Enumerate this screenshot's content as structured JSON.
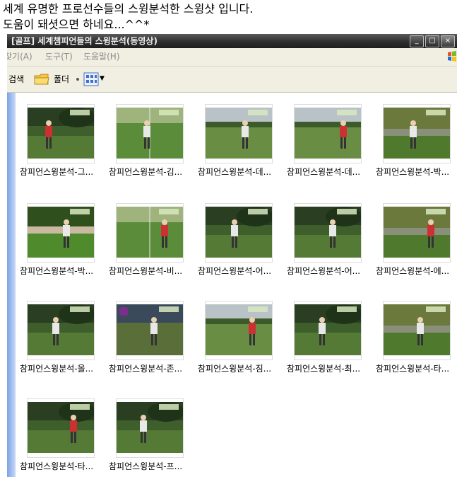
{
  "post": {
    "line1": "세계 유명한 프로선수들의 스윙분석한 스윙샷 입니다.",
    "line2": "도움이 돼셧으면 하네요...^^*"
  },
  "window": {
    "title": "[골프] 세계챔피언들의 스윙분석(동영상)",
    "controls": {
      "minimize": "_",
      "maximize": "□",
      "close": "×"
    }
  },
  "menu": [
    "찾기(A)",
    "도구(T)",
    "도움말(H)"
  ],
  "toolbar": {
    "search_label": "검색",
    "folders_label": "폴더"
  },
  "colors": {
    "titlebar": "#2e2e2e",
    "menubar": "#f1efe2",
    "left_pane": "#7ba2e7"
  },
  "files": [
    {
      "name": "참피언스윙분석-그...",
      "scene": "grass-dark"
    },
    {
      "name": "참피언스윙분석-김...",
      "scene": "split-grass"
    },
    {
      "name": "참피언스윙분석-데...",
      "scene": "fairway-sky"
    },
    {
      "name": "참피언스윙분석-데...",
      "scene": "fairway-sky"
    },
    {
      "name": "참피언스윙분석-박...",
      "scene": "crowd-trees"
    },
    {
      "name": "참피언스윙분석-박...",
      "scene": "crowd-green"
    },
    {
      "name": "참피언스윙분석-비...",
      "scene": "split-grass"
    },
    {
      "name": "참피언스윙분석-어...",
      "scene": "grass-dark"
    },
    {
      "name": "참피언스윙분석-어...",
      "scene": "grass-dark"
    },
    {
      "name": "참피언스윙분석-에...",
      "scene": "crowd-trees"
    },
    {
      "name": "참피언스윙분석-올...",
      "scene": "grass-dark"
    },
    {
      "name": "참피언스윙분석-존...",
      "scene": "crowd-purple"
    },
    {
      "name": "참피언스윙분석-짐...",
      "scene": "fairway-sky"
    },
    {
      "name": "참피언스윙분석-최...",
      "scene": "grass-dark"
    },
    {
      "name": "참피언스윙분석-타...",
      "scene": "crowd-trees"
    },
    {
      "name": "참피언스윙분석-타...",
      "scene": "grass-dark"
    },
    {
      "name": "참피언스윙분석-프...",
      "scene": "grass-dark"
    }
  ]
}
